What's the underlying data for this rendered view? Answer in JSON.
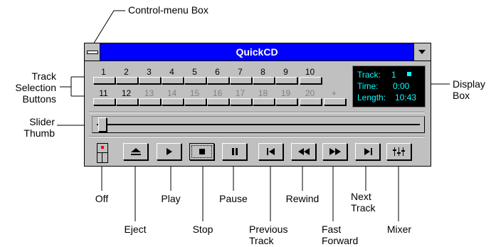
{
  "window": {
    "title": "QuickCD",
    "tracks_row1": [
      "1",
      "2",
      "3",
      "4",
      "5",
      "6",
      "7",
      "8",
      "9",
      "10"
    ],
    "tracks_row2": [
      "11",
      "12",
      "13",
      "14",
      "15",
      "16",
      "17",
      "18",
      "19",
      "20",
      "+"
    ],
    "display": {
      "track_label": "Track:",
      "track_value": "1",
      "time_label": "Time:",
      "time_value": "0:00",
      "length_label": "Length:",
      "length_value": "10:43"
    }
  },
  "callouts": {
    "control_menu_box": "Control-menu Box",
    "track_selection_1": "Track",
    "track_selection_2": "Selection",
    "track_selection_3": "Buttons",
    "display_box_1": "Display",
    "display_box_2": "Box",
    "slider_thumb_1": "Slider",
    "slider_thumb_2": "Thumb",
    "off": "Off",
    "eject": "Eject",
    "play": "Play",
    "stop": "Stop",
    "pause": "Pause",
    "previous_track_1": "Previous",
    "previous_track_2": "Track",
    "rewind": "Rewind",
    "fast_forward_1": "Fast",
    "fast_forward_2": "Forward",
    "next_track_1": "Next",
    "next_track_2": "Track",
    "mixer": "Mixer"
  },
  "colors": {
    "titlebar": "#0000ff",
    "display_bg": "#000000",
    "display_text": "#00ffff",
    "window_face": "#c0c0c0"
  }
}
